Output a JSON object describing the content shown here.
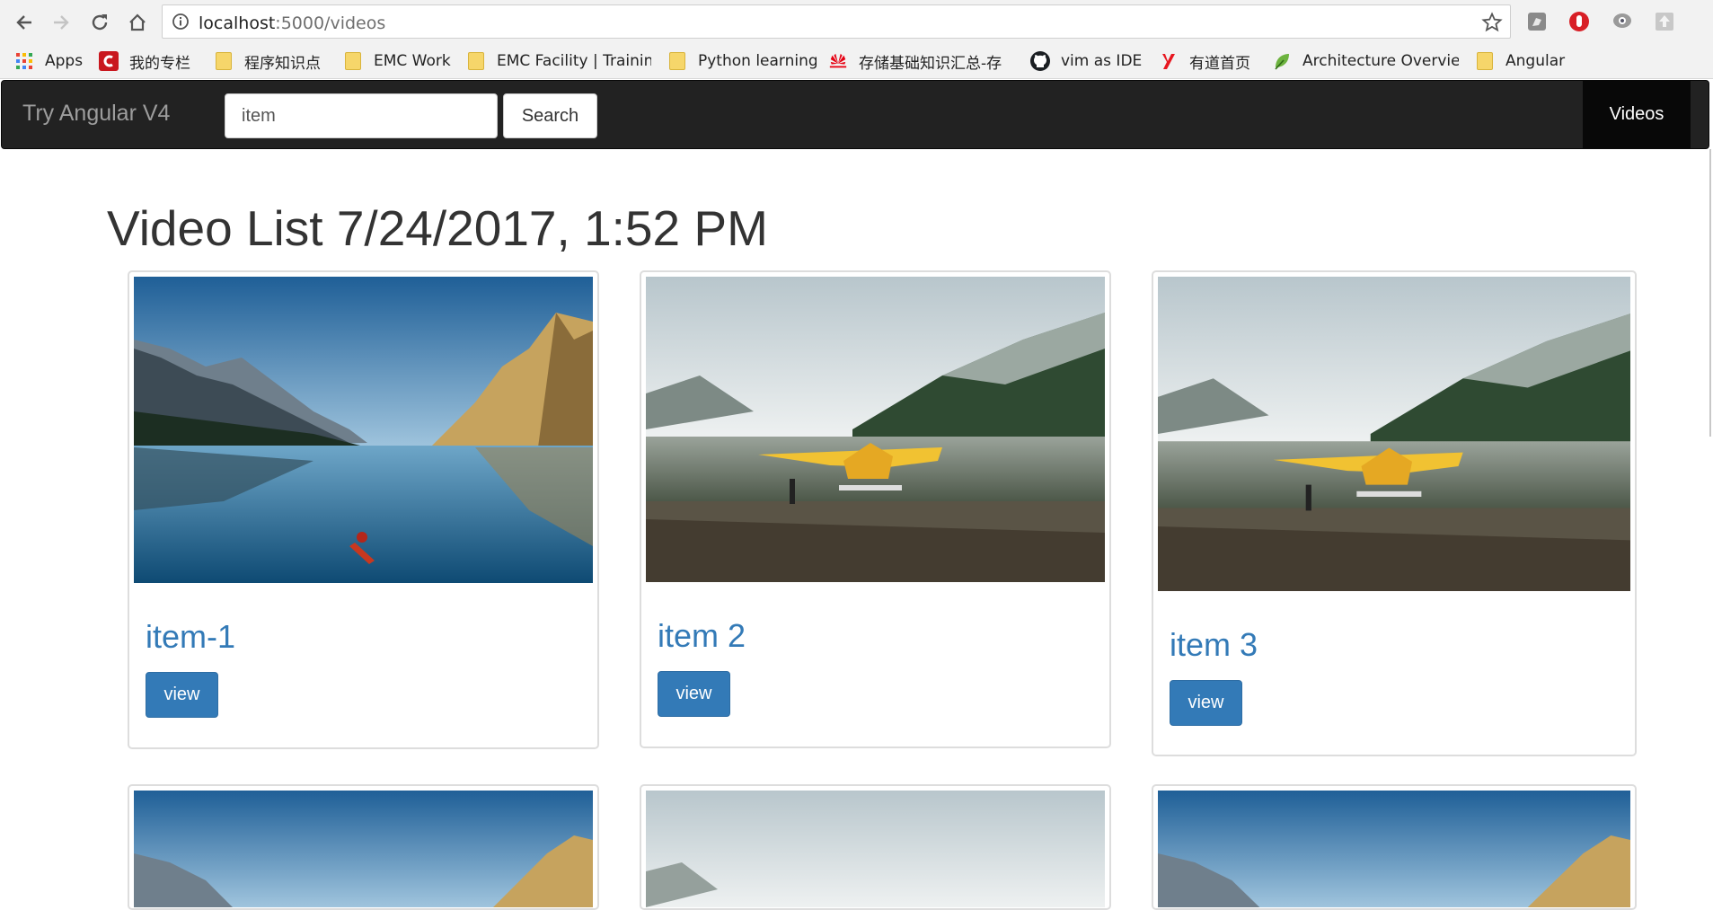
{
  "browser": {
    "url_host": "localhost",
    "url_path": ":5000/videos",
    "bookmarks": [
      {
        "label": "Apps",
        "icon": "apps-grid-icon"
      },
      {
        "label": "我的专栏",
        "icon": "csdn-icon"
      },
      {
        "label": "程序知识点",
        "icon": "folder-icon"
      },
      {
        "label": "EMC Work",
        "icon": "folder-icon"
      },
      {
        "label": "EMC Facility | Training",
        "icon": "folder-icon"
      },
      {
        "label": "Python learning",
        "icon": "folder-icon"
      },
      {
        "label": "存储基础知识汇总-存",
        "icon": "huawei-icon"
      },
      {
        "label": "vim as IDE",
        "icon": "github-icon"
      },
      {
        "label": "有道首页",
        "icon": "youdao-icon"
      },
      {
        "label": "Architecture Overview",
        "icon": "leaf-icon"
      },
      {
        "label": "Angular",
        "icon": "folder-icon"
      }
    ]
  },
  "navbar": {
    "brand": "Try Angular V4",
    "search_value": "item",
    "search_button": "Search",
    "active_link": "Videos"
  },
  "main": {
    "title": "Video List 7/24/2017, 1:52 PM",
    "cards": [
      {
        "title": "item-1",
        "button": "view",
        "image": "lake-kayak"
      },
      {
        "title": "item 2",
        "button": "view",
        "image": "lake-seaplane"
      },
      {
        "title": "item 3",
        "button": "view",
        "image": "lake-seaplane"
      },
      {
        "title": "",
        "button": "",
        "image": "lake-kayak"
      },
      {
        "title": "",
        "button": "",
        "image": "lake-seaplane"
      },
      {
        "title": "",
        "button": "",
        "image": "lake-kayak"
      }
    ]
  },
  "colors": {
    "navbar_bg": "#222222",
    "link_blue": "#337ab7",
    "button_blue": "#337ab7"
  }
}
